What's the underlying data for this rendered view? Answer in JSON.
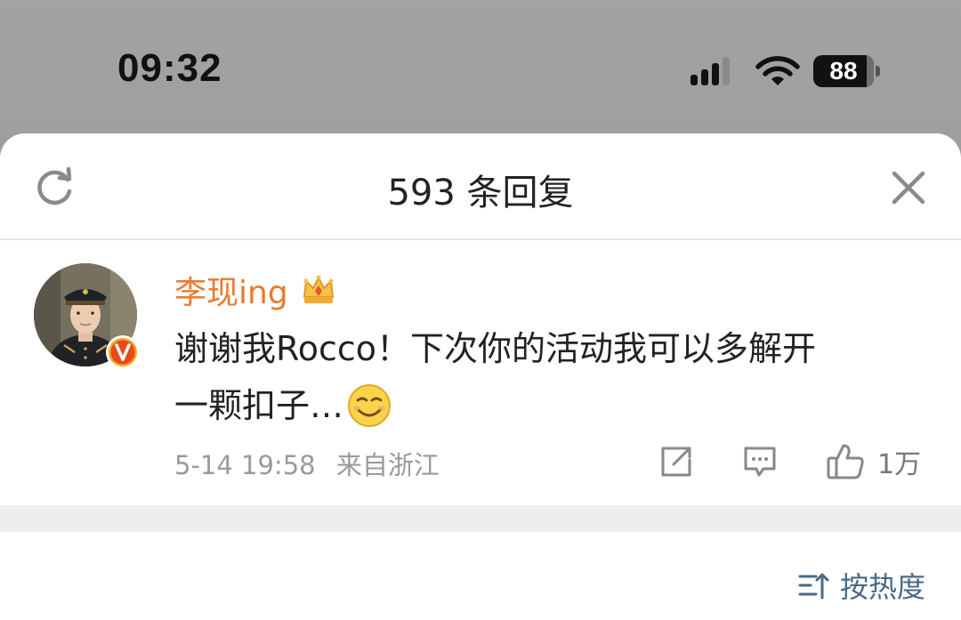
{
  "status_bar": {
    "time": "09:32",
    "battery": "88",
    "battery_level": 0.88
  },
  "sheet": {
    "title": "593 条回复"
  },
  "comment": {
    "username": "李现ing",
    "text_line1": "谢谢我Rocco！下次你的活动我可以多解开",
    "text_line2": "一颗扣子…",
    "date": "5-14 19:58",
    "location": "来自浙江",
    "like_count": "1万"
  },
  "footer": {
    "sort_label": "按热度"
  },
  "colors": {
    "username": "#eb7a2c",
    "sort_label": "#4a6a86",
    "meta_text": "#9a9a9a"
  }
}
